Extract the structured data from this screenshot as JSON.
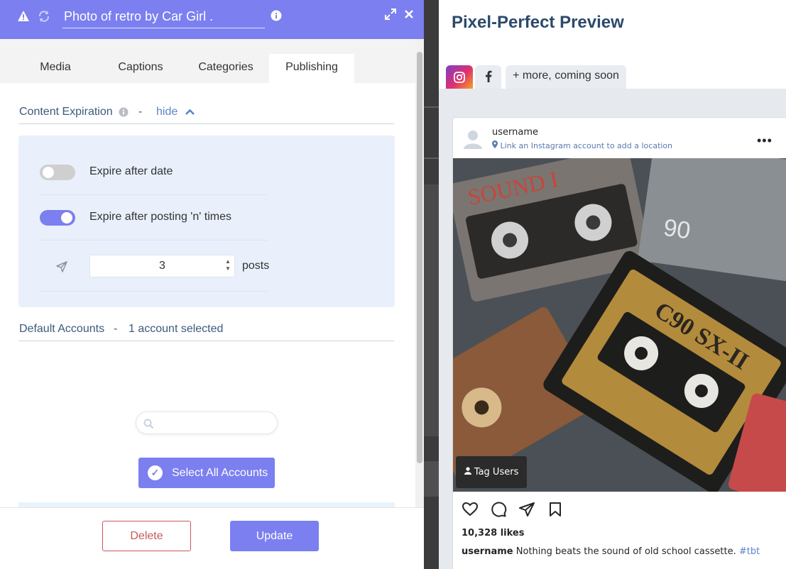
{
  "editor": {
    "title_value": "Photo of retro by Car Girl .",
    "tabs": [
      {
        "label": "Media"
      },
      {
        "label": "Captions"
      },
      {
        "label": "Categories"
      },
      {
        "label": "Publishing",
        "active": true
      }
    ],
    "content_expiration": {
      "label": "Content Expiration",
      "separator": "-",
      "toggle_label": "hide",
      "options": [
        {
          "label": "Expire after date",
          "enabled": false
        },
        {
          "label": "Expire after posting 'n' times",
          "enabled": true
        }
      ],
      "post_count": "3",
      "post_unit": "posts"
    },
    "default_accounts": {
      "label": "Default Accounts",
      "separator": "-",
      "summary": "1 account selected"
    },
    "search": {
      "placeholder": ""
    },
    "select_all_label": "Select All Accounts",
    "delete_label": "Delete",
    "update_label": "Update"
  },
  "preview": {
    "title": "Pixel-Perfect Preview",
    "platform_tabs": [
      {
        "icon": "instagram-icon",
        "active": true
      },
      {
        "icon": "facebook-icon"
      },
      {
        "label": "+ more, coming soon"
      }
    ],
    "post": {
      "username": "username",
      "location": "Link an Instagram account to add a location",
      "tag_users_label": "Tag Users",
      "likes": "10,328 likes",
      "caption_username": "username",
      "caption_text": "Nothing beats the sound of old school cassette.",
      "hashtag": "#tbt"
    }
  },
  "colors": {
    "accent": "#7b7ff0",
    "danger": "#c9585a",
    "heading": "#2c4a6b",
    "panel_bg": "#e9f0fb"
  }
}
